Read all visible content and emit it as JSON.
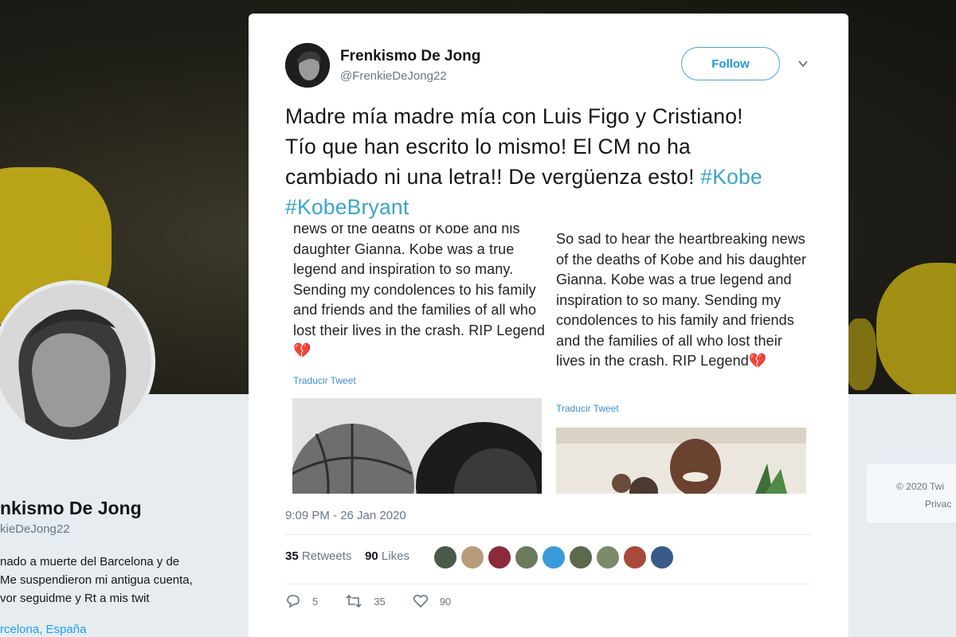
{
  "profile": {
    "name": "nkismo De Jong",
    "handle": "kieDeJong22",
    "bio": [
      "nado a muerte del Barcelona y de",
      "Me suspendieron mi antigua cuenta,",
      "vor seguidme y Rt a mis twit"
    ],
    "location": "rcelona, España",
    "footer": [
      "© 2020 Twi",
      "Privac"
    ]
  },
  "tweet": {
    "author_name": "Frenkismo De Jong",
    "author_handle": "@FrenkieDeJong22",
    "follow_label": "Follow",
    "text": "Madre mía madre mía con Luis Figo y Cristiano! Tío que han escrito lo mismo! El CM no ha cambiado ni una letra!! De vergüenza esto! ",
    "hashtags": [
      "#Kobe",
      "#KobeBryant"
    ],
    "embedded": {
      "left_text": "news of the deaths of Kobe and his daughter Gianna. Kobe was a true legend and inspiration to so many. Sending my condolences to his family and friends and the families of all who lost their lives in the crash. RIP Legend",
      "right_text": "So sad to hear the heartbreaking news of the deaths of Kobe and his daughter Gianna. Kobe was a true legend and inspiration to so many. Sending my condolences to his family and friends and the families of all who lost their lives in the crash. RIP Legend",
      "heart_emoji": "💔",
      "translate_label": "Traducir Tweet"
    },
    "timestamp": "9:09 PM - 26 Jan 2020",
    "retweets_count": "35",
    "retweets_label": "Retweets",
    "likes_count": "90",
    "likes_label": "Likes",
    "liker_colors": [
      "#4a5a4a",
      "#b89c7a",
      "#8a2a3a",
      "#6a7a5a",
      "#3a9ad9",
      "#5a6a4a",
      "#7a8a6a",
      "#a84a3a",
      "#3a5a8a"
    ],
    "actions": {
      "reply_count": "5",
      "retweet_count": "35",
      "like_count": "90"
    }
  },
  "colors": {
    "accent": "#1b95e0",
    "hashtag": "#3ca4c8"
  }
}
